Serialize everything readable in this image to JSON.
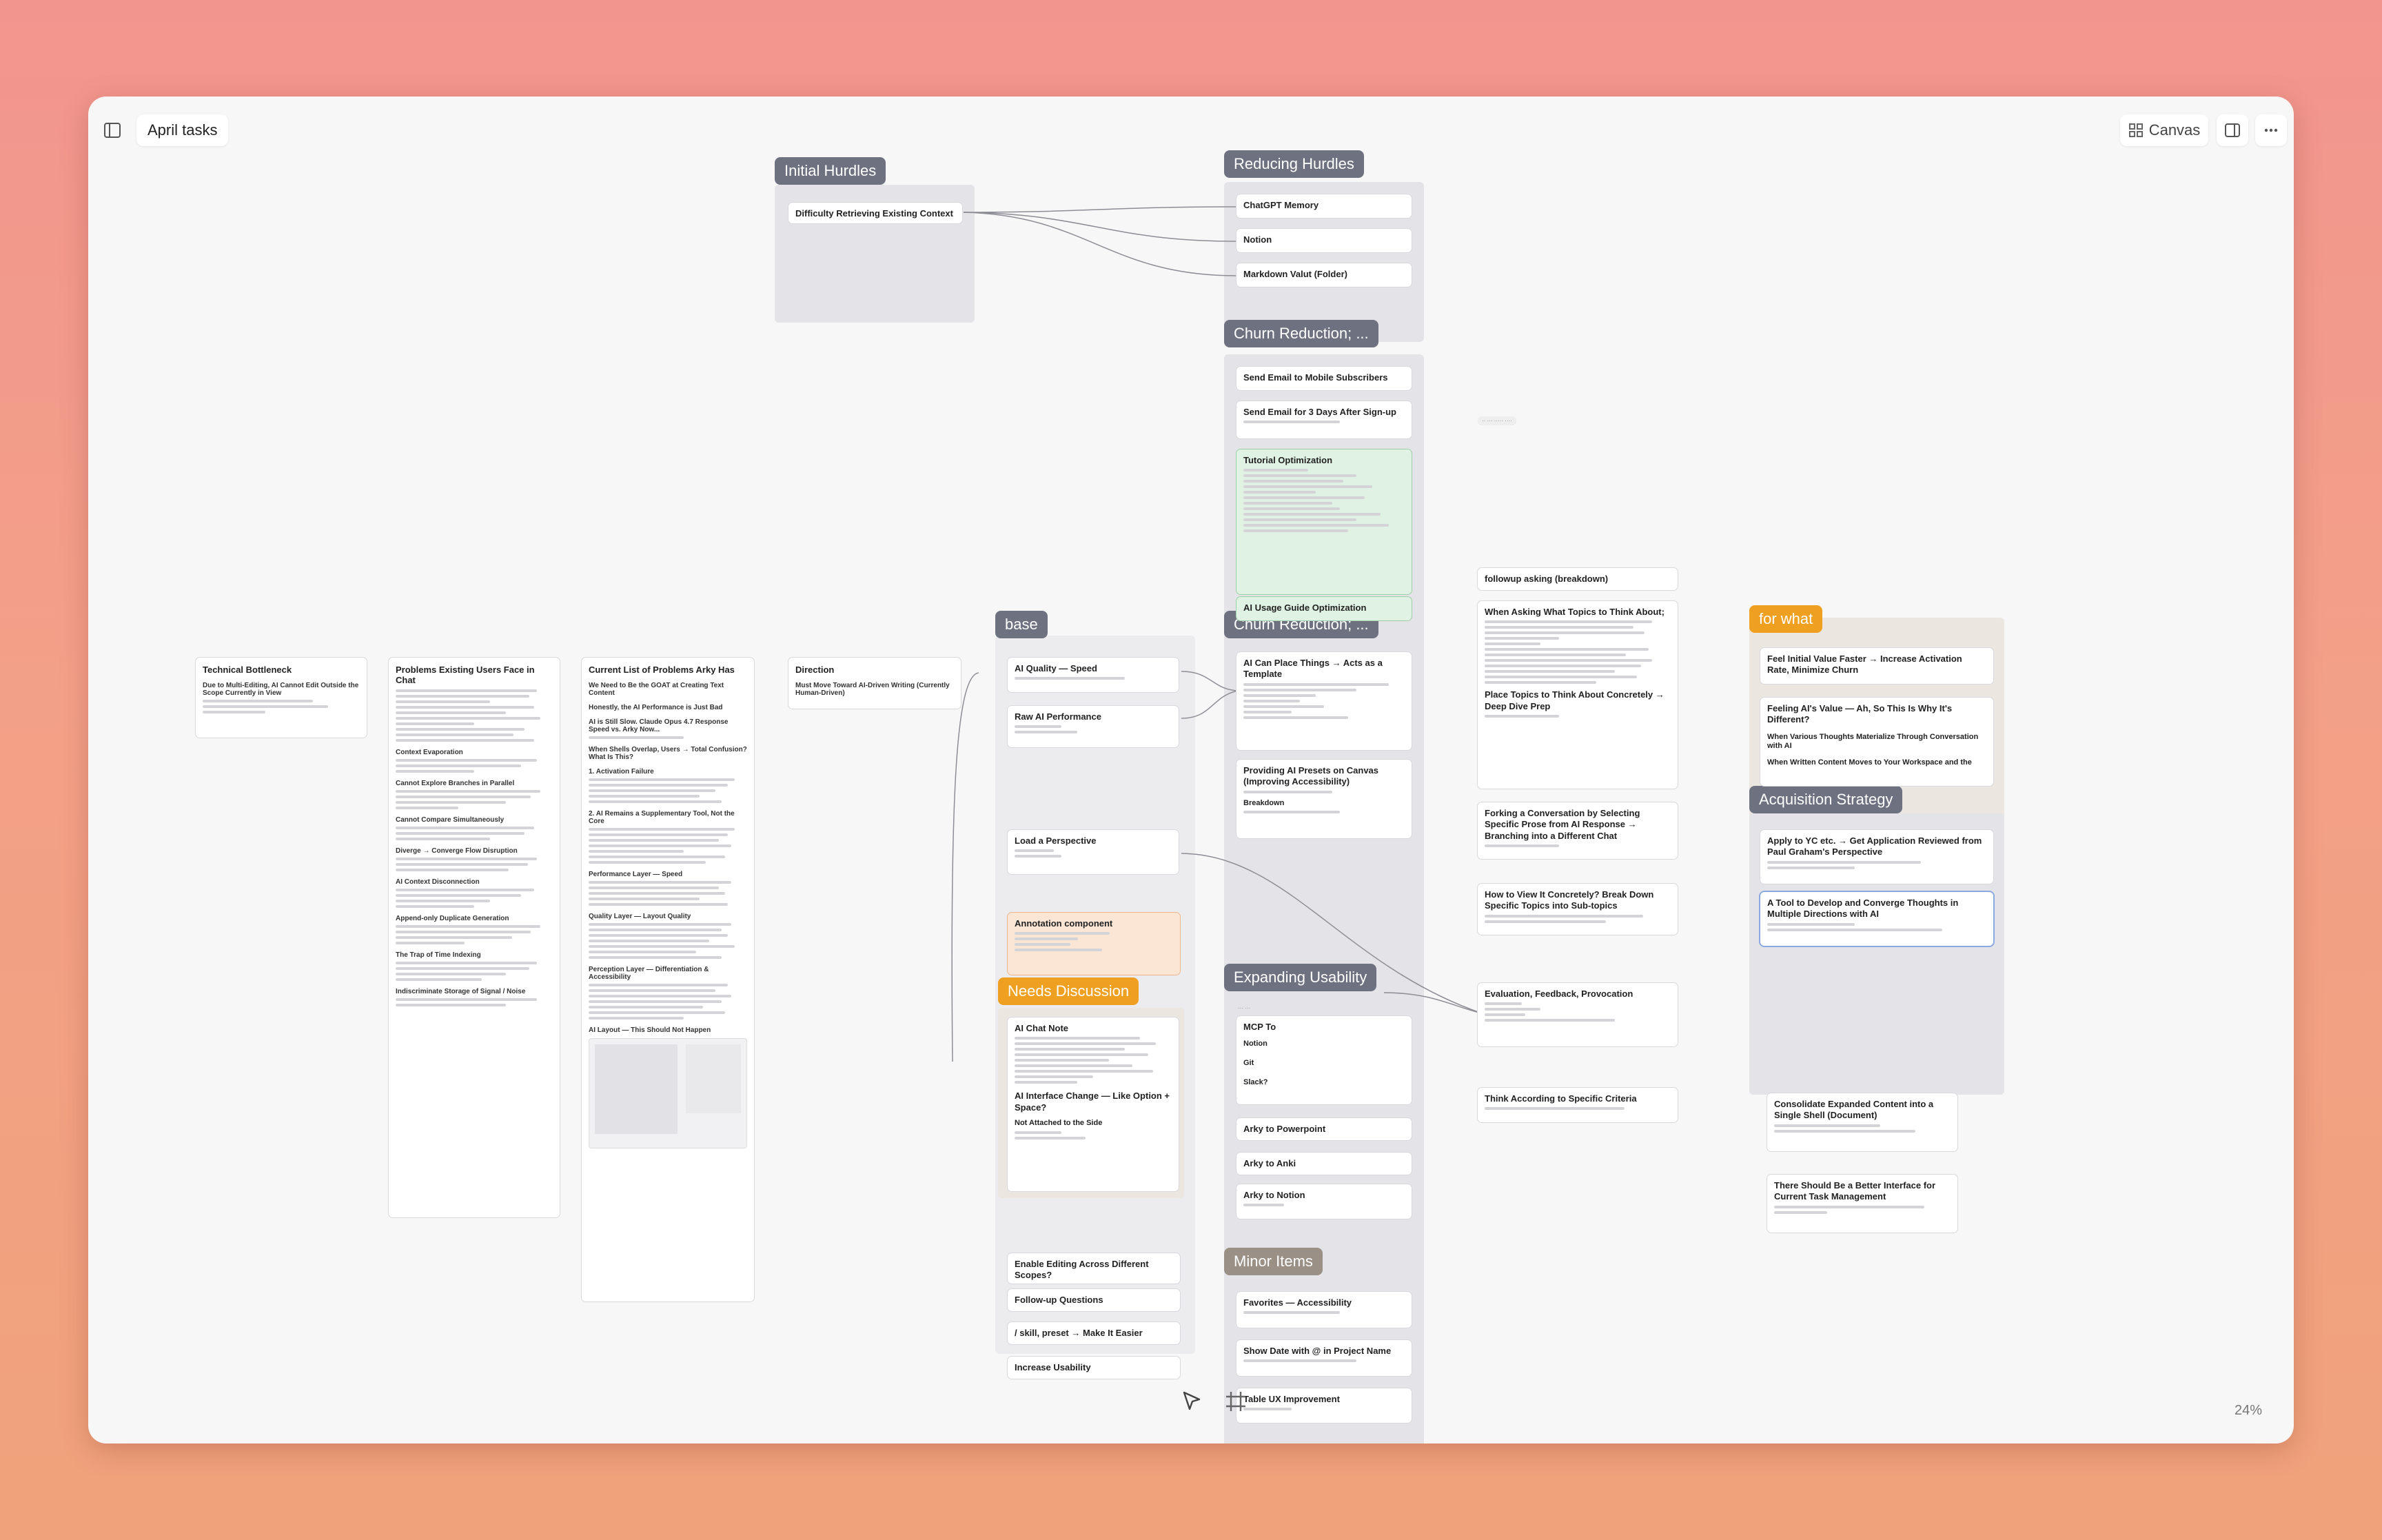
{
  "window": {
    "title": "April tasks",
    "view_label": "Canvas",
    "zoom": "24%"
  },
  "labels": {
    "initial_hurdles": "Initial Hurdles",
    "reducing_hurdles": "Reducing Hurdles",
    "churn_reduction_1": "Churn Reduction; ...",
    "churn_reduction_2": "Churn Reduction; ...",
    "base": "base",
    "for_what": "for what",
    "acquisition_strategy": "Acquisition Strategy",
    "needs_discussion": "Needs Discussion",
    "expanding_usability": "Expanding Usability",
    "minor_items": "Minor Items"
  },
  "cards": {
    "difficulty": "Difficulty Retrieving Existing Context",
    "chatgpt_memory": "ChatGPT Memory",
    "notion": "Notion",
    "markdown_vault": "Markdown Valut (Folder)",
    "send_email_mobile": "Send Email to Mobile Subscribers",
    "send_email_3days": "Send Email for 3 Days After Sign-up",
    "tutorial_opt": "Tutorial Optimization",
    "ai_usage_guide": "AI Usage Guide Optimization",
    "technical_bottleneck": "Technical Bottleneck",
    "technical_bottleneck_sub": "Due to Multi-Editing, AI Cannot Edit Outside the Scope Currently in View",
    "problems_chat": "Problems Existing Users Face in Chat",
    "problems_chat_subs": [
      "Context Evaporation",
      "Cannot Explore Branches in Parallel",
      "Cannot Compare Simultaneously",
      "Diverge → Converge Flow Disruption",
      "AI Context Disconnection",
      "Append-only Duplicate Generation",
      "The Trap of Time Indexing",
      "Indiscriminate Storage of Signal / Noise"
    ],
    "current_list": "Current List of Problems Arky Has",
    "current_list_subs": [
      "We Need to Be the GOAT at Creating Text Content",
      "Honestly, the AI Performance is Just Bad",
      "AI is Still Slow. Claude Opus 4.7 Response Speed vs. Arky Now...",
      "When Shells Overlap, Users → Total Confusion? What Is This?",
      "1. Activation Failure",
      "2. AI Remains a Supplementary Tool, Not the Core",
      "Performance Layer — Speed",
      "Quality Layer — Layout Quality",
      "Perception Layer — Differentiation & Accessibility",
      "AI Layout — This Should Not Happen"
    ],
    "direction": "Direction",
    "direction_sub": "Must Move Toward AI-Driven Writing (Currently Human-Driven)",
    "ai_quality_speed": "AI Quality — Speed",
    "raw_ai_perf": "Raw AI Performance",
    "load_perspective": "Load a Perspective",
    "annotation_component": "Annotation component",
    "ai_place_things": "AI Can Place Things → Acts as a Template",
    "ai_presets": "Providing AI Presets on Canvas (Improving Accessibility)",
    "breakdown": "Breakdown",
    "ai_chat_note": "AI Chat Note",
    "ai_interface_change": "AI Interface Change — Like Option + Space?",
    "not_attached": "Not Attached to the Side",
    "mcp_to": "MCP To",
    "mcp_notion": "Notion",
    "mcp_git": "Git",
    "mcp_slack": "Slack?",
    "arky_ppt": "Arky to Powerpoint",
    "arky_anki": "Arky to Anki",
    "arky_notion": "Arky to Notion",
    "enable_editing": "Enable Editing Across Different Scopes?",
    "followup_questions": "Follow-up Questions",
    "skill_preset": "/ skill, preset → Make It Easier",
    "increase_usability": "Increase Usability",
    "favorites": "Favorites — Accessibility",
    "show_date": "Show Date with @ in Project Name",
    "table_ux": "Table UX Improvement",
    "followup_asking": "followup asking (breakdown)",
    "when_asking": "When Asking What Topics to Think About;",
    "place_topics": "Place Topics to Think About Concretely → Deep Dive Prep",
    "forking": "Forking a Conversation by Selecting Specific Prose from AI Response → Branching into a Different Chat",
    "how_to_view": "How to View It Concretely? Break Down Specific Topics into Sub-topics",
    "evaluation": "Evaluation, Feedback, Provocation",
    "think_criteria": "Think According to Specific Criteria",
    "feel_value": "Feel Initial Value Faster → Increase Activation Rate, Minimize Churn",
    "feeling_ai": "Feeling AI's Value — Ah, So This Is Why It's Different?",
    "when_various": "When Various Thoughts Materialize Through Conversation with AI",
    "when_written": "When Written Content Moves to Your Workspace and the",
    "apply_yc": "Apply to YC etc. → Get Application Reviewed from Paul Graham's Perspective",
    "tool_converge": "A Tool to Develop and Converge Thoughts in Multiple Directions with AI",
    "consolidate": "Consolidate Expanded Content into a Single Shell (Document)",
    "better_interface": "There Should Be a Better Interface for Current Task Management"
  },
  "icons": [
    "sidebar-toggle-icon",
    "canvas-grid-icon",
    "panel-icon",
    "more-icon",
    "cursor-icon",
    "frame-icon"
  ],
  "colors": {
    "gray_label": "#6e7280",
    "orange_label": "#f0a020",
    "green_card": "#e0f2e3",
    "peach_card": "#fbe6d6"
  }
}
